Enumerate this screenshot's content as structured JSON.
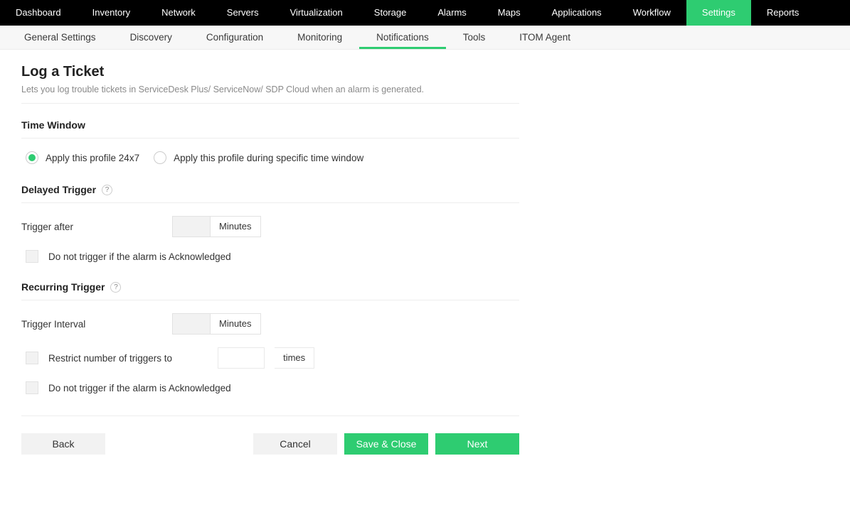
{
  "topnav": [
    {
      "label": "Dashboard",
      "active": false
    },
    {
      "label": "Inventory",
      "active": false
    },
    {
      "label": "Network",
      "active": false
    },
    {
      "label": "Servers",
      "active": false
    },
    {
      "label": "Virtualization",
      "active": false
    },
    {
      "label": "Storage",
      "active": false
    },
    {
      "label": "Alarms",
      "active": false
    },
    {
      "label": "Maps",
      "active": false
    },
    {
      "label": "Applications",
      "active": false
    },
    {
      "label": "Workflow",
      "active": false
    },
    {
      "label": "Settings",
      "active": true
    },
    {
      "label": "Reports",
      "active": false
    }
  ],
  "subnav": [
    {
      "label": "General Settings",
      "active": false
    },
    {
      "label": "Discovery",
      "active": false
    },
    {
      "label": "Configuration",
      "active": false
    },
    {
      "label": "Monitoring",
      "active": false
    },
    {
      "label": "Notifications",
      "active": true
    },
    {
      "label": "Tools",
      "active": false
    },
    {
      "label": "ITOM Agent",
      "active": false
    }
  ],
  "page": {
    "title": "Log a Ticket",
    "desc": "Lets you log trouble tickets in ServiceDesk Plus/ ServiceNow/ SDP Cloud when an alarm is generated."
  },
  "sections": {
    "time_window": {
      "heading": "Time Window",
      "radio1": "Apply this profile 24x7",
      "radio2": "Apply this profile during specific time window"
    },
    "delayed": {
      "heading": "Delayed Trigger",
      "help": "?",
      "trigger_after_label": "Trigger after",
      "trigger_after_value": "",
      "unit": "Minutes",
      "ack_label": "Do not trigger if the alarm is Acknowledged"
    },
    "recurring": {
      "heading": "Recurring Trigger",
      "help": "?",
      "interval_label": "Trigger Interval",
      "interval_value": "",
      "unit": "Minutes",
      "restrict_label": "Restrict number of triggers to",
      "restrict_value": "",
      "restrict_unit": "times",
      "ack_label": "Do not trigger if the alarm is Acknowledged"
    }
  },
  "buttons": {
    "back": "Back",
    "cancel": "Cancel",
    "save": "Save & Close",
    "next": "Next"
  }
}
